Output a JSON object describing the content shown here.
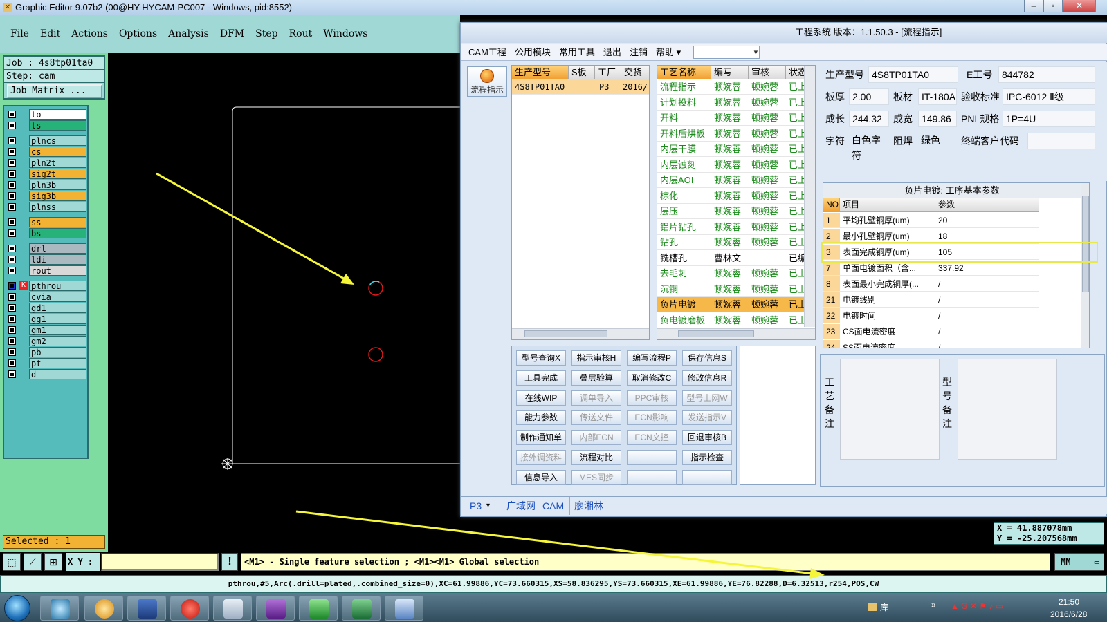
{
  "window": {
    "title": "Graphic Editor 9.07b2 (00@HY-HYCAM-PC007 - Windows, pid:8552)",
    "minimize": "–",
    "maximize": "▫",
    "close": "✕"
  },
  "menu": [
    "File",
    "Edit",
    "Actions",
    "Options",
    "Analysis",
    "DFM",
    "Step",
    "Rout",
    "Windows"
  ],
  "job": {
    "job_line": "Job : 4s8tp01ta0",
    "step_line": "Step: cam",
    "matrix_button": "Job Matrix ..."
  },
  "layers": [
    {
      "name": "to",
      "color": "#ffffff"
    },
    {
      "name": "ts",
      "color": "#27b27a"
    },
    {
      "name": "plncs",
      "color": "#9fd8d5"
    },
    {
      "name": "cs",
      "color": "#f2b233"
    },
    {
      "name": "pln2t",
      "color": "#9fd8d5"
    },
    {
      "name": "sig2t",
      "color": "#f2b233"
    },
    {
      "name": "pln3b",
      "color": "#9fd8d5"
    },
    {
      "name": "sig3b",
      "color": "#f2b233"
    },
    {
      "name": "plnss",
      "color": "#9fd8d5"
    },
    {
      "name": "ss",
      "color": "#f2b233"
    },
    {
      "name": "bs",
      "color": "#27b27a"
    },
    {
      "name": "drl",
      "color": "#aab8bf"
    },
    {
      "name": "ldi",
      "color": "#aab8bf"
    },
    {
      "name": "rout",
      "color": "#d8d8d8"
    },
    {
      "name": "pthrou",
      "color": "#9fd8d5"
    },
    {
      "name": "cvia",
      "color": "#9fd8d5"
    },
    {
      "name": "gd1",
      "color": "#9fd8d5"
    },
    {
      "name": "gg1",
      "color": "#9fd8d5"
    },
    {
      "name": "gm1",
      "color": "#9fd8d5"
    },
    {
      "name": "gm2",
      "color": "#9fd8d5"
    },
    {
      "name": "pb",
      "color": "#9fd8d5"
    },
    {
      "name": "pt",
      "color": "#9fd8d5"
    },
    {
      "name": "d",
      "color": "#9fd8d5"
    }
  ],
  "selected_text": "Selected : 1",
  "cam": {
    "title": "工程系统  版本：1.1.50.3 - [流程指示]",
    "menu": [
      "CAM工程",
      "公用模块",
      "常用工具",
      "退出",
      "注销",
      "帮助 ▾"
    ],
    "flow_button": "流程指示",
    "left_grid": {
      "headers": [
        "生产型号",
        "S板",
        "工厂",
        "交货日"
      ],
      "row": [
        "4S8TP01TA0",
        "",
        "P3",
        "2016/"
      ]
    },
    "process_grid": {
      "headers": [
        "工艺名称",
        "编写",
        "审核",
        "状态"
      ],
      "rows": [
        [
          "流程指示",
          "顿婉蓉",
          "顿婉蓉",
          "已上"
        ],
        [
          "计划投料",
          "顿婉蓉",
          "顿婉蓉",
          "已上"
        ],
        [
          "开料",
          "顿婉蓉",
          "顿婉蓉",
          "已上"
        ],
        [
          "开料后烘板",
          "顿婉蓉",
          "顿婉蓉",
          "已上"
        ],
        [
          "内层干膜",
          "顿婉蓉",
          "顿婉蓉",
          "已上"
        ],
        [
          "内层蚀刻",
          "顿婉蓉",
          "顿婉蓉",
          "已上"
        ],
        [
          "内层AOI",
          "顿婉蓉",
          "顿婉蓉",
          "已上"
        ],
        [
          "棕化",
          "顿婉蓉",
          "顿婉蓉",
          "已上"
        ],
        [
          "层压",
          "顿婉蓉",
          "顿婉蓉",
          "已上"
        ],
        [
          "铝片钻孔",
          "顿婉蓉",
          "顿婉蓉",
          "已上"
        ],
        [
          "钻孔",
          "顿婉蓉",
          "顿婉蓉",
          "已上"
        ],
        [
          "铣槽孔",
          "曹林文",
          "",
          "已编"
        ],
        [
          "去毛刺",
          "顿婉蓉",
          "顿婉蓉",
          "已上"
        ],
        [
          "沉铜",
          "顿婉蓉",
          "顿婉蓉",
          "已上"
        ],
        [
          "负片电镀",
          "顿婉蓉",
          "顿婉蓉",
          "已上"
        ],
        [
          "负电镀磨板",
          "顿婉蓉",
          "顿婉蓉",
          "已上"
        ]
      ],
      "selected_index": 14
    },
    "buttons": [
      {
        "label": "型号查询X",
        "enabled": true
      },
      {
        "label": "指示审核H",
        "enabled": true
      },
      {
        "label": "编写流程P",
        "enabled": true
      },
      {
        "label": "保存信息S",
        "enabled": true
      },
      {
        "label": "工具完成",
        "enabled": true
      },
      {
        "label": "叠层验算",
        "enabled": true
      },
      {
        "label": "取消修改C",
        "enabled": true
      },
      {
        "label": "修改信息R",
        "enabled": true
      },
      {
        "label": "在线WIP",
        "enabled": true
      },
      {
        "label": "调单导入",
        "enabled": false
      },
      {
        "label": "PPC审核",
        "enabled": false
      },
      {
        "label": "型号上网W",
        "enabled": false
      },
      {
        "label": "能力参数",
        "enabled": true
      },
      {
        "label": "传送文件",
        "enabled": false
      },
      {
        "label": "ECN影响",
        "enabled": false
      },
      {
        "label": "发送指示V",
        "enabled": false
      },
      {
        "label": "制作通知单",
        "enabled": true
      },
      {
        "label": "内部ECN",
        "enabled": false
      },
      {
        "label": "ECN文控",
        "enabled": false
      },
      {
        "label": "回退审核B",
        "enabled": true
      },
      {
        "label": "接外调资料",
        "enabled": false
      },
      {
        "label": "流程对比",
        "enabled": true
      },
      {
        "label": "",
        "enabled": true
      },
      {
        "label": "指示检查",
        "enabled": true
      },
      {
        "label": "信息导入",
        "enabled": true
      },
      {
        "label": "MES同步",
        "enabled": false
      },
      {
        "label": "",
        "enabled": true
      },
      {
        "label": "",
        "enabled": true
      }
    ],
    "info": {
      "part_label": "生产型号",
      "part": "4S8TP01TA0",
      "eno_label": "E工号",
      "eno": "844782",
      "thick_label": "板厚",
      "thick": "2.00",
      "mat_label": "板材",
      "mat": "IT-180A",
      "std_label": "验收标准",
      "std": "IPC-6012 Ⅱ级",
      "len_label": "成长",
      "len": "244.32",
      "wid_label": "成宽",
      "wid": "149.86",
      "pnl_label": "PNL规格",
      "pnl": "1P=4U",
      "char_label": "字符",
      "char": "白色字符",
      "mask_label": "阻焊",
      "mask": "绿色",
      "cust_label": "终端客户代码",
      "cust": ""
    },
    "param_grid": {
      "title": "负片电镀: 工序基本参数",
      "headers": [
        "NO",
        "项目",
        "参数"
      ],
      "rows": [
        [
          "1",
          "平均孔壁铜厚(um)",
          "20"
        ],
        [
          "2",
          "最小孔壁铜厚(um)",
          "18"
        ],
        [
          "3",
          "表面完成铜厚(um)",
          "105"
        ],
        [
          "7",
          "单面电镀面积（含...",
          "337.92"
        ],
        [
          "8",
          "表面最小完成铜厚(...",
          "/"
        ],
        [
          "21",
          "电镀线别",
          "/"
        ],
        [
          "22",
          "电镀时间",
          "/"
        ],
        [
          "23",
          "CS面电流密度",
          "/"
        ],
        [
          "24",
          "SS面电流密度",
          "/"
        ]
      ]
    },
    "notes": {
      "proc_label": "工艺备注",
      "type_label": "型号备注"
    },
    "statusbar": [
      "P3",
      "广域网",
      "CAM",
      "廖湘林"
    ]
  },
  "coords": {
    "x": "X =  41.887078mm",
    "y": "Y = -25.207568mm"
  },
  "xy_label": "X Y :",
  "hint": "<M1> - Single feature selection ; <M1><M1> Global selection",
  "units": "MM",
  "feature_line": "pthrou,#5,Arc(.drill=plated,.combined_size=0),XC=61.99886,YC=73.660315,XS=58.836295,YS=73.660315,XE=61.99886,YE=76.82288,D=6.32513,r254,POS,CW",
  "tray": {
    "library": "库",
    "time": "21:50",
    "date": "2016/6/28"
  },
  "accent": {
    "yellow_arrow": "#f5f53a",
    "highlight_frame": "#e8e84a",
    "circle": "#e01818"
  }
}
